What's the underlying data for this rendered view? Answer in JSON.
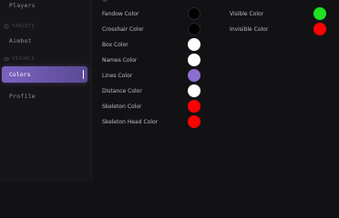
{
  "sidebar": {
    "items": [
      {
        "label": "Players"
      },
      {
        "label": "TARGETS"
      },
      {
        "label": "Aimbot"
      },
      {
        "label": "VISUALS"
      },
      {
        "label": "Colors"
      },
      {
        "label": "Profile"
      }
    ]
  },
  "colors_left": [
    {
      "label": "Fandow Color",
      "color": "#000000"
    },
    {
      "label": "Crosshair Color",
      "color": "#000000"
    },
    {
      "label": "Box Color",
      "color": "#ffffff"
    },
    {
      "label": "Names Color",
      "color": "#ffffff"
    },
    {
      "label": "Lines Color",
      "color": "#8b6fd0"
    },
    {
      "label": "Distance Color",
      "color": "#ffffff"
    },
    {
      "label": "Skeleton Color",
      "color": "#ff0000"
    },
    {
      "label": "Skeleton Head Color",
      "color": "#ff0000"
    }
  ],
  "colors_right": [
    {
      "label": "Visible Color",
      "color": "#22e022"
    },
    {
      "label": "Invisible Color",
      "color": "#ff0000"
    }
  ]
}
